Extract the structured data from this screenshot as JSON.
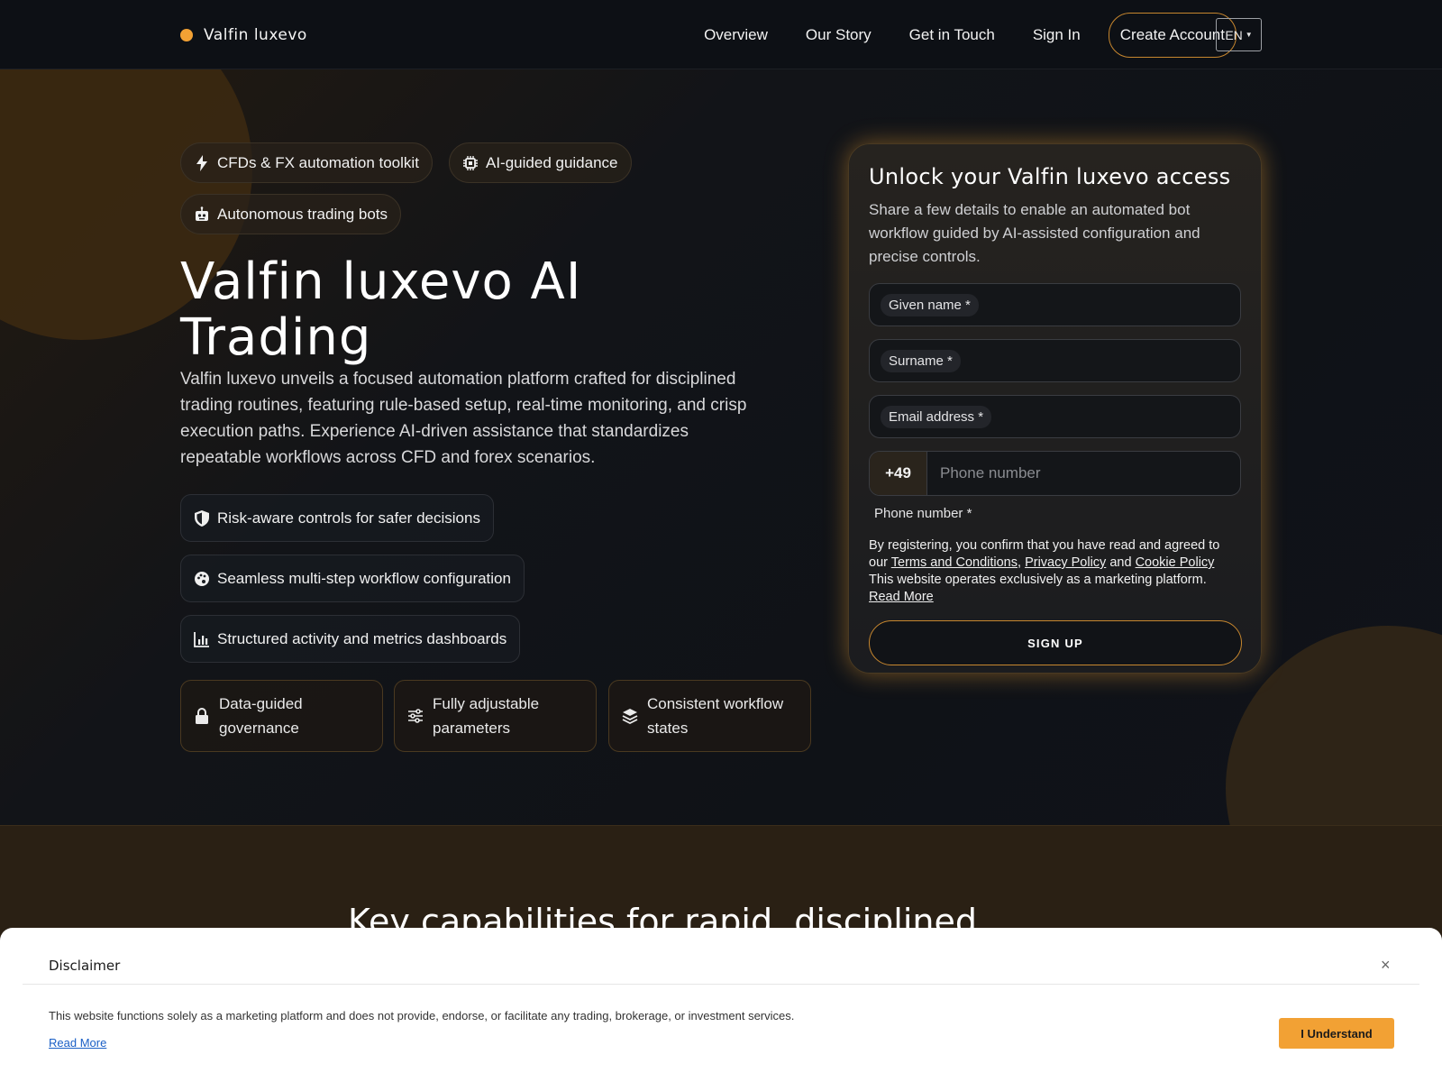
{
  "header": {
    "brand": "Valfin luxevo",
    "nav": [
      "Overview",
      "Our Story",
      "Get in Touch",
      "Sign In"
    ],
    "cta": "Create Account",
    "lang": "EN"
  },
  "hero": {
    "pills": [
      "CFDs & FX automation toolkit",
      "AI-guided guidance",
      "Autonomous trading bots"
    ],
    "title": "Valfin luxevo AI Trading",
    "description": "Valfin luxevo unveils a focused automation platform crafted for disciplined trading routines, featuring rule-based setup, real-time monitoring, and crisp execution paths. Experience AI-driven assistance that standardizes repeatable workflows across CFD and forex scenarios.",
    "features": [
      "Risk-aware controls for safer decisions",
      "Seamless multi-step workflow configuration",
      "Structured activity and metrics dashboards"
    ],
    "cards": [
      "Data-guided governance",
      "Fully adjustable parameters",
      "Consistent workflow states"
    ]
  },
  "form": {
    "title": "Unlock your Valfin luxevo access",
    "subtitle": "Share a few details to enable an automated bot workflow guided by AI-assisted configuration and precise controls.",
    "given_name": "Given name *",
    "surname": "Surname *",
    "email": "Email address *",
    "phone_code": "+49",
    "phone_placeholder": "Phone number",
    "phone_label": "Phone number *",
    "legal_prefix": "By registering, you confirm that you have read and agreed to our",
    "terms": "Terms and Conditions",
    "privacy": "Privacy Policy",
    "and": "and",
    "cookie": "Cookie Policy",
    "legal_suffix": "This website operates exclusively as a marketing platform.",
    "read_more": "Read More",
    "submit": "SIGN UP"
  },
  "section2": {
    "title": "Key capabilities for rapid, disciplined"
  },
  "disclaimer": {
    "title": "Disclaimer",
    "text": "This website functions solely as a marketing platform and does not provide, endorse, or facilitate any trading, brokerage, or investment services.",
    "read_more": "Read More",
    "button": "I Understand",
    "close": "×"
  },
  "colors": {
    "accent": "#f2a134",
    "background": "#0f1217"
  }
}
